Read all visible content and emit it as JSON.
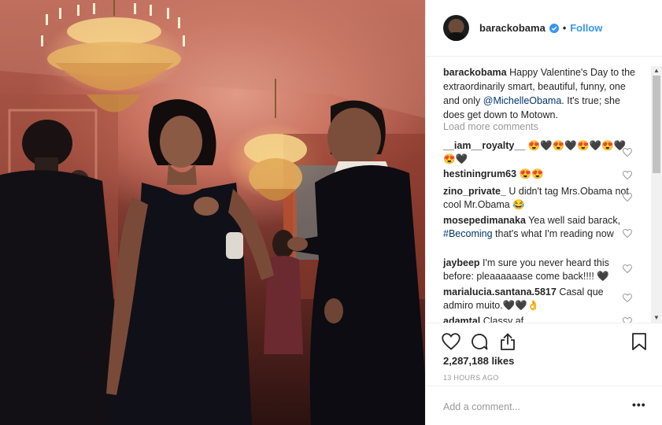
{
  "post": {
    "image_alt": "Couple dancing under chandeliers",
    "header": {
      "username": "barackobama",
      "separator": "•",
      "follow_label": "Follow"
    },
    "caption": {
      "username": "barackobama",
      "text_1": "Happy Valentine's Day to the extraordinarily smart, beautiful, funny, one and only",
      "mention": "@MichelleObama",
      "text_2": ". It's true; she does get down to Motown."
    },
    "load_more_label": "Load more comments",
    "comments": [
      {
        "username": "__iam__royalty__",
        "text": "😍🖤😍🖤😍🖤😍🖤😍🖤"
      },
      {
        "username": "hestiningrum63",
        "text": "😍😍"
      },
      {
        "username": "zino_private_",
        "text": "U didn't tag Mrs.Obama not cool Mr.Obama 😂"
      },
      {
        "username": "mosepedimanaka",
        "text_1": "Yea well said barack,",
        "hashtag": "#Becoming",
        "text_2": "that's what I'm reading now"
      },
      {
        "username": "jaybeep",
        "text": "I'm sure you never heard this before: pleaaaaaase come back!!!! 🖤"
      },
      {
        "username": "marialucia.santana.5817",
        "text": "Casal que admiro muito.🖤🖤👌"
      },
      {
        "username": "adamtal",
        "text": "Classy af"
      }
    ],
    "likes": "2,287,188 likes",
    "timestamp": "13 HOURS AGO",
    "add_comment_placeholder": "Add a comment...",
    "more_label": "•••"
  },
  "colors": {
    "link_blue": "#3897f0",
    "mention_blue": "#003569",
    "text": "#262626",
    "muted": "#999999",
    "border": "#efefef"
  }
}
